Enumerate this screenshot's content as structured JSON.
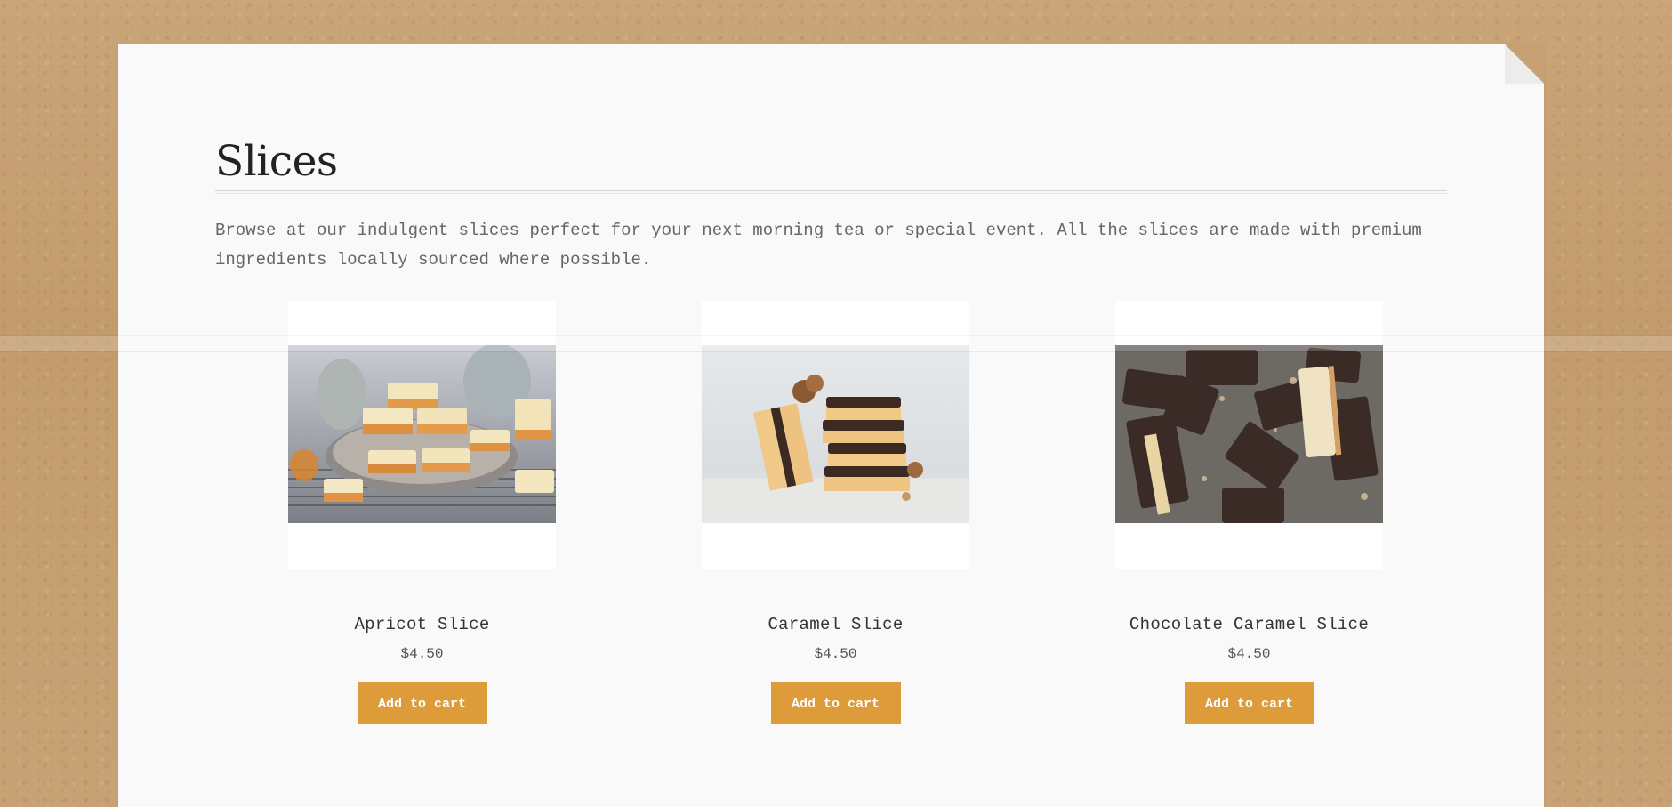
{
  "page": {
    "title": "Slices",
    "intro": "Browse at our indulgent slices perfect for your next morning tea or special event. All the slices are made with premium ingredients locally sourced where possible."
  },
  "products": [
    {
      "name": "Apricot Slice",
      "price": "$4.50",
      "button_label": "Add to cart"
    },
    {
      "name": "Caramel Slice",
      "price": "$4.50",
      "button_label": "Add to cart"
    },
    {
      "name": "Chocolate Caramel Slice",
      "price": "$4.50",
      "button_label": "Add to cart"
    }
  ],
  "colors": {
    "accent": "#dd9b3a",
    "background": "#c9a377",
    "sheet": "#f9f9f9"
  }
}
